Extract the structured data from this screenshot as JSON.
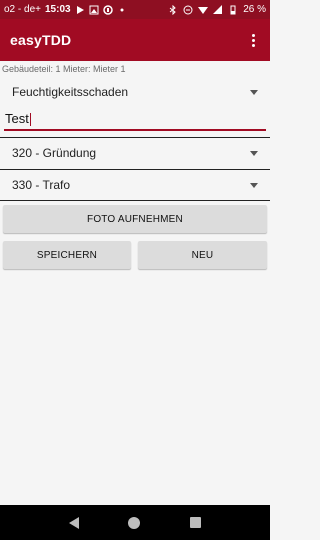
{
  "status_bar": {
    "carrier": "o2 - de+",
    "time": "15:03",
    "battery": "26 %"
  },
  "app_bar": {
    "title": "easyTDD",
    "menu_icon": "more-vert-icon"
  },
  "subtitle": "Gebäudeteil: 1 Mieter: Mieter 1",
  "form": {
    "damage_type": "Feuchtigkeitsschaden",
    "description_value": "Test",
    "category_1": "320 - Gründung",
    "category_2": "330 - Trafo"
  },
  "buttons": {
    "photo": "FOTO AUFNEHMEN",
    "save": "SPEICHERN",
    "new": "NEU"
  },
  "colors": {
    "primary": "#a10b23",
    "status_bar": "#8e0f22",
    "background": "#f5f5f5",
    "button": "#dcdcdc"
  }
}
